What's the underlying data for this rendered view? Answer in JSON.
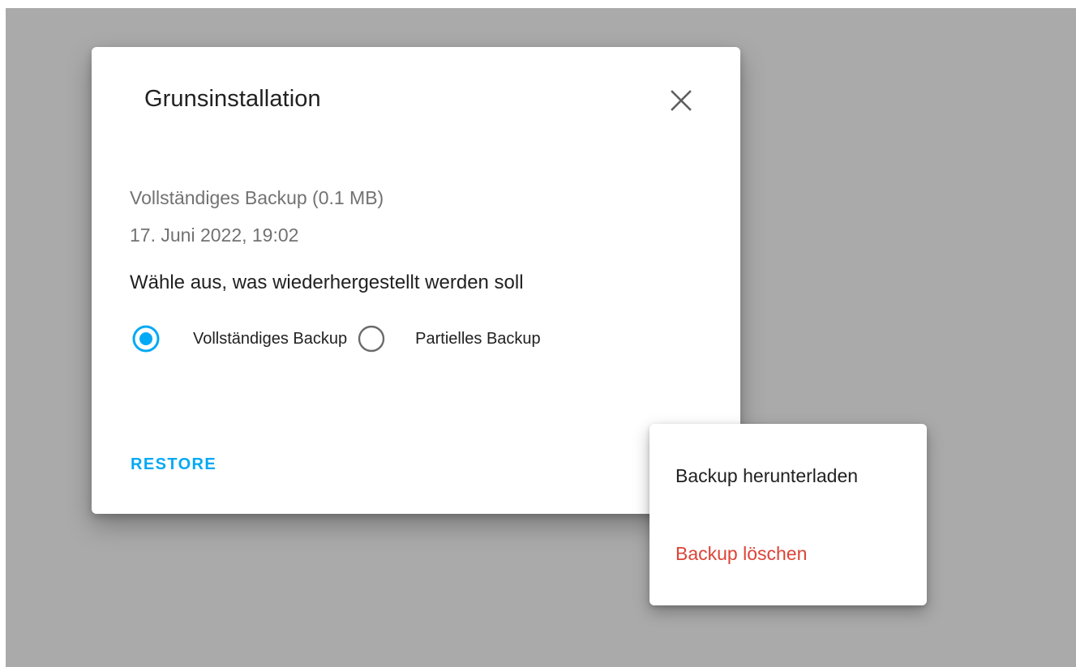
{
  "dialog": {
    "title": "Grunsinstallation",
    "close_icon": "close-icon",
    "backup_info": {
      "type_and_size": "Vollständiges Backup (0.1 MB)",
      "date": "17. Juni 2022, 19:02"
    },
    "question": "Wähle aus, was wiederhergestellt werden soll",
    "options": [
      {
        "label": "Vollständiges Backup",
        "selected": true
      },
      {
        "label": "Partielles Backup",
        "selected": false
      }
    ],
    "restore_label": "RESTORE"
  },
  "menu": {
    "items": [
      {
        "label": "Backup herunterladen",
        "color": "#212121"
      },
      {
        "label": "Backup löschen",
        "color": "#db4437"
      }
    ]
  },
  "colors": {
    "accent": "#03a9f4",
    "danger": "#db4437",
    "scrim": "#aaaaaa",
    "text_primary": "#212121",
    "text_secondary": "#727272"
  }
}
